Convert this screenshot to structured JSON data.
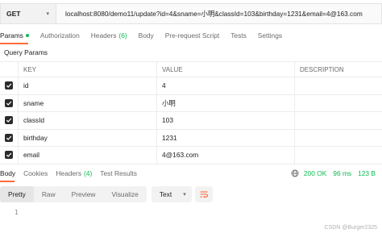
{
  "request": {
    "method": "GET",
    "url": "localhost:8080/demo11/update?id=4&sname=小明&classId=103&birthday=1231&email=4@163.com"
  },
  "request_tabs": [
    {
      "label": "Params",
      "active": true,
      "dot": true
    },
    {
      "label": "Authorization"
    },
    {
      "label": "Headers",
      "count": "(6)"
    },
    {
      "label": "Body"
    },
    {
      "label": "Pre-request Script"
    },
    {
      "label": "Tests"
    },
    {
      "label": "Settings"
    }
  ],
  "query_params": {
    "label": "Query Params",
    "columns": {
      "key": "KEY",
      "value": "VALUE",
      "description": "DESCRIPTION"
    },
    "rows": [
      {
        "checked": true,
        "key": "id",
        "value": "4",
        "description": ""
      },
      {
        "checked": true,
        "key": "sname",
        "value": "小明",
        "description": ""
      },
      {
        "checked": true,
        "key": "classId",
        "value": "103",
        "description": ""
      },
      {
        "checked": true,
        "key": "birthday",
        "value": "1231",
        "description": ""
      },
      {
        "checked": true,
        "key": "email",
        "value": "4@163.com",
        "description": ""
      }
    ]
  },
  "response_tabs": [
    {
      "label": "Body",
      "active": true
    },
    {
      "label": "Cookies"
    },
    {
      "label": "Headers",
      "count": "(4)"
    },
    {
      "label": "Test Results"
    }
  ],
  "response_status": {
    "status": "200 OK",
    "time": "96 ms",
    "size": "123 B"
  },
  "format": {
    "buttons": [
      "Pretty",
      "Raw",
      "Preview",
      "Visualize"
    ],
    "active": "Pretty",
    "select_value": "Text"
  },
  "body_lines": [
    "1"
  ],
  "watermark": "CSDN @Burger2325",
  "colors": {
    "accent": "#ff6c37",
    "success": "#0cbb52"
  }
}
